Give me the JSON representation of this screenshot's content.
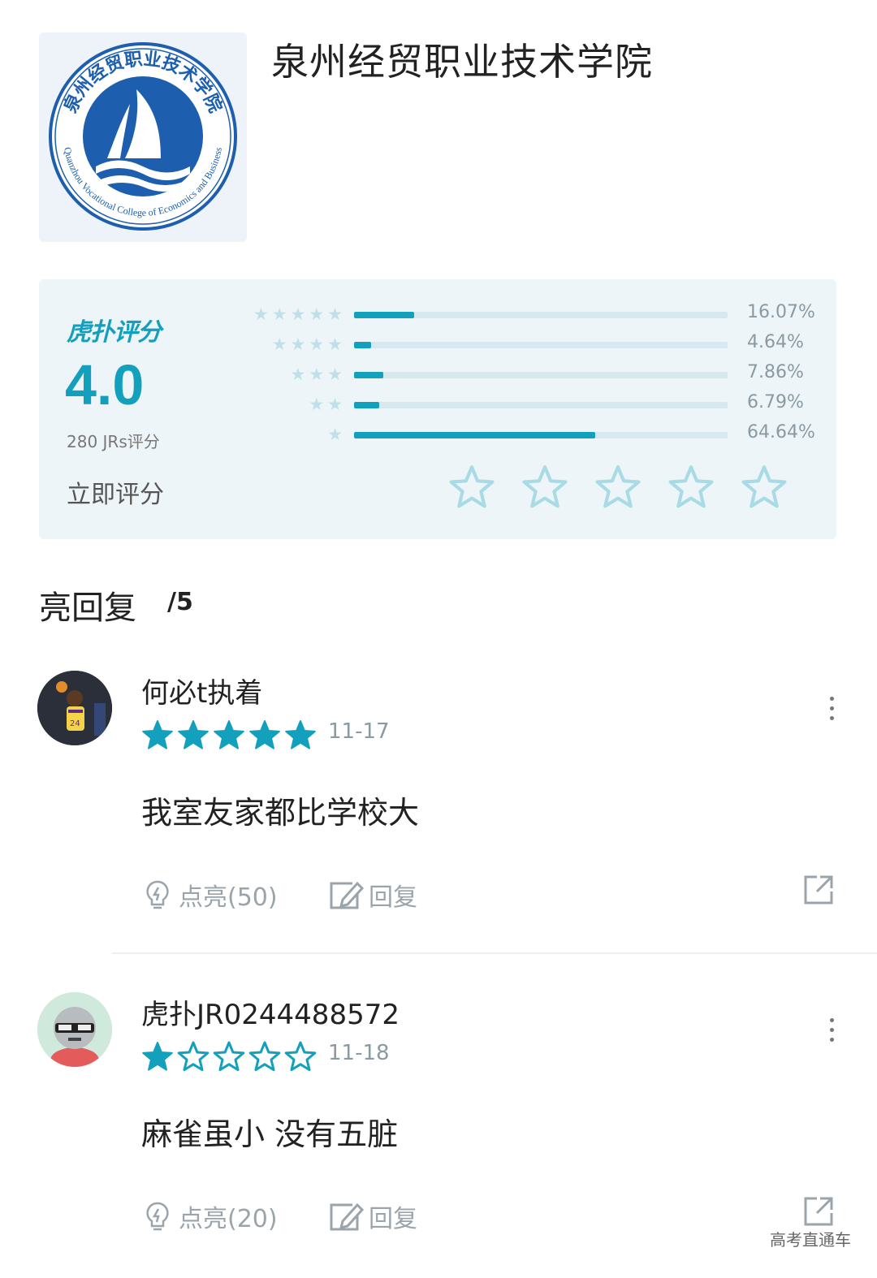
{
  "school": {
    "name": "泉州经贸职业技术学院",
    "logo_text_cn": "泉州经贸职业技术学院",
    "logo_text_en": "Quanzhou Vocational College of Economics and Business"
  },
  "rating": {
    "brand": "虎扑评分",
    "score": "4.0",
    "count_label": "280 JRs评分",
    "rate_now_label": "立即评分",
    "distribution": [
      {
        "stars": 5,
        "fraction": 0.1607,
        "label": "16.07%"
      },
      {
        "stars": 4,
        "fraction": 0.0464,
        "label": "4.64%"
      },
      {
        "stars": 3,
        "fraction": 0.0786,
        "label": "7.86%"
      },
      {
        "stars": 2,
        "fraction": 0.0679,
        "label": "6.79%"
      },
      {
        "stars": 1,
        "fraction": 0.6464,
        "label": "64.64%"
      }
    ],
    "accent_color": "#13a0bd"
  },
  "replies": {
    "title": "亮回复",
    "count": "/5",
    "items": [
      {
        "user": "何必t执着",
        "stars": 5,
        "date": "11-17",
        "text": "我室友家都比学校大",
        "like_label": "点亮(50)",
        "reply_label": "回复",
        "avatar_icon": "basketball-player-avatar"
      },
      {
        "user": "虎扑JR0244488572",
        "stars": 1,
        "date": "11-18",
        "text": "麻雀虽小 没有五脏",
        "like_label": "点亮(20)",
        "reply_label": "回复",
        "avatar_icon": "cartoon-sunglasses-avatar"
      }
    ]
  },
  "watermark": "高考直通车"
}
